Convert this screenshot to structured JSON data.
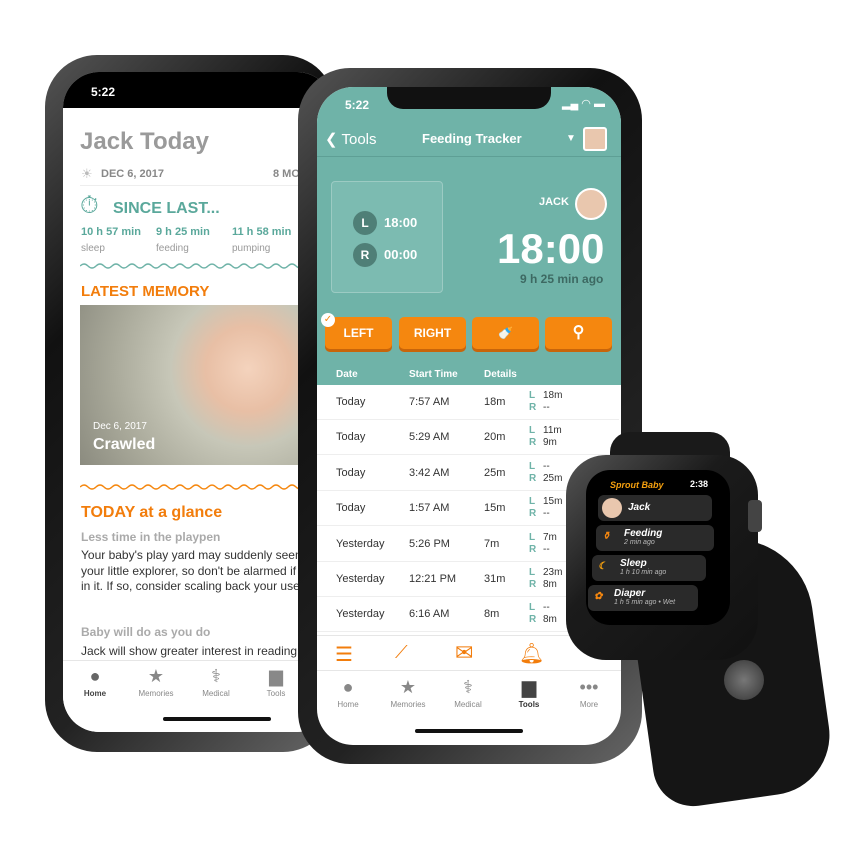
{
  "left_phone": {
    "status_time": "5:22",
    "title": "Jack Today",
    "date": "DEC 6, 2017",
    "age_partial": "8 MO",
    "since_last": {
      "heading": "SINCE LAST...",
      "items": [
        {
          "value": "10 h 57 min",
          "label": "sleep"
        },
        {
          "value": "9 h 25 min",
          "label": "feeding"
        },
        {
          "value": "11 h 58 min",
          "label": "pumping"
        }
      ]
    },
    "latest_memory": {
      "heading": "LATEST MEMORY",
      "date": "Dec 6, 2017",
      "caption": "Crawled"
    },
    "glance": {
      "heading": "TODAY at a glance",
      "sections": [
        {
          "title": "Less time in the playpen",
          "body": "Your baby's play yard may suddenly seem confining for your little explorer, so don't be alarmed if he gets fussy in it. If so, consider scaling back your use of it."
        },
        {
          "title": "Baby will do as you do",
          "body": "Jack will show greater interest in reading"
        }
      ]
    },
    "tabs": [
      {
        "label": "Home",
        "icon": "baby-face-icon"
      },
      {
        "label": "Memories",
        "icon": "star-icon"
      },
      {
        "label": "Medical",
        "icon": "stethoscope-icon"
      },
      {
        "label": "Tools",
        "icon": "toolbox-icon"
      }
    ]
  },
  "right_phone": {
    "status_time": "5:22",
    "nav": {
      "back_label": "Tools",
      "title": "Feeding Tracker"
    },
    "timer": {
      "left_label": "L",
      "left_time": "18:00",
      "right_label": "R",
      "right_time": "00:00",
      "baby_name": "JACK",
      "total": "18:00",
      "ago": "9 h 25 min ago"
    },
    "buttons": [
      {
        "label": "LEFT",
        "selected": true
      },
      {
        "label": "RIGHT"
      },
      {
        "icon": "bottle-icon"
      },
      {
        "icon": "spoon-icon"
      }
    ],
    "table": {
      "headers": [
        "Date",
        "Start Time",
        "Details"
      ],
      "rows": [
        {
          "date": "Today",
          "start": "7:57 AM",
          "duration": "18m",
          "left": "18m",
          "right": "--"
        },
        {
          "date": "Today",
          "start": "5:29 AM",
          "duration": "20m",
          "left": "11m",
          "right": "9m"
        },
        {
          "date": "Today",
          "start": "3:42 AM",
          "duration": "25m",
          "left": "--",
          "right": "25m"
        },
        {
          "date": "Today",
          "start": "1:57 AM",
          "duration": "15m",
          "left": "15m",
          "right": "--"
        },
        {
          "date": "Yesterday",
          "start": "5:26 PM",
          "duration": "7m",
          "left": "7m",
          "right": "--"
        },
        {
          "date": "Yesterday",
          "start": "12:21 PM",
          "duration": "31m",
          "left": "23m",
          "right": "8m"
        },
        {
          "date": "Yesterday",
          "start": "6:16 AM",
          "duration": "8m",
          "left": "--",
          "right": "8m"
        }
      ],
      "l": "L",
      "r": "R"
    },
    "toolbar_icons": [
      "list-icon",
      "trend-icon",
      "mail-icon",
      "bell-icon"
    ],
    "tabs": [
      {
        "label": "Home"
      },
      {
        "label": "Memories"
      },
      {
        "label": "Medical"
      },
      {
        "label": "Tools"
      },
      {
        "label": "More"
      }
    ]
  },
  "watch": {
    "app_name": "Sprout Baby",
    "time": "2:38",
    "items": [
      {
        "title": "Jack",
        "sub": ""
      },
      {
        "title": "Feeding",
        "sub": "2 min ago"
      },
      {
        "title": "Sleep",
        "sub": "1 h 10 min ago"
      },
      {
        "title": "Diaper",
        "sub": "1 h 5 min ago • Wet"
      }
    ]
  },
  "colors": {
    "teal": "#6fb3a8",
    "orange": "#f5870f",
    "text_teal": "#5aa89b"
  }
}
